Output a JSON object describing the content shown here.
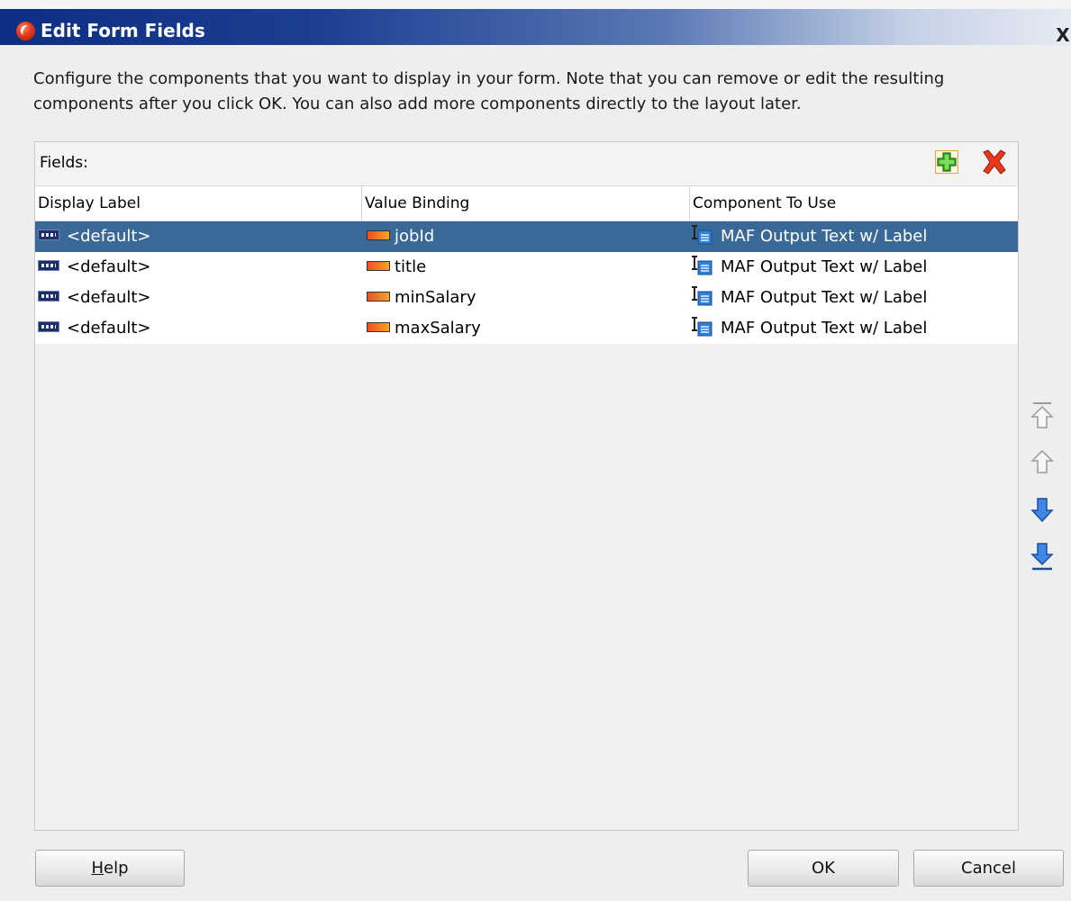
{
  "window": {
    "title": "Edit Form Fields",
    "close_label": "X"
  },
  "description": "Configure the components that you want to display in your form.  Note that you can remove or edit the resulting components after you click OK.  You can also add more components directly to the layout later.",
  "fields_panel": {
    "label": "Fields:",
    "columns": [
      "Display Label",
      "Value Binding",
      "Component To Use"
    ],
    "rows": [
      {
        "display_label": "<default>",
        "value_binding": "jobId",
        "component": "MAF Output Text w/ Label",
        "selected": true
      },
      {
        "display_label": "<default>",
        "value_binding": "title",
        "component": "MAF Output Text w/ Label",
        "selected": false
      },
      {
        "display_label": "<default>",
        "value_binding": "minSalary",
        "component": "MAF Output Text w/ Label",
        "selected": false
      },
      {
        "display_label": "<default>",
        "value_binding": "maxSalary",
        "component": "MAF Output Text w/ Label",
        "selected": false
      }
    ],
    "selected_row_color": "#3a6997"
  },
  "reorder_icons": [
    "move-top-icon",
    "move-up-icon",
    "move-down-icon",
    "move-bottom-icon"
  ],
  "buttons": {
    "help_mnemonic": "H",
    "help_rest": "elp",
    "ok": "OK",
    "cancel": "Cancel"
  }
}
